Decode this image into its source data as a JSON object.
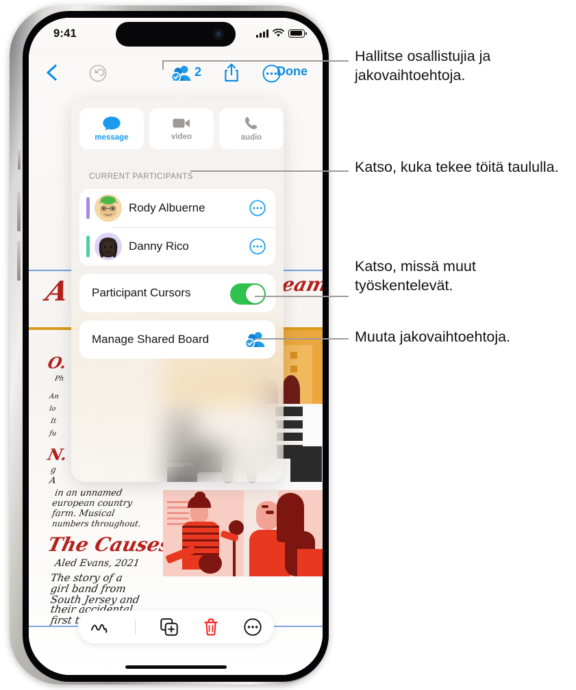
{
  "status_bar": {
    "time": "9:41",
    "cellular_icon": "signal-bars-icon",
    "wifi_icon": "wifi-icon",
    "battery_icon": "battery-icon"
  },
  "nav_bar": {
    "back_icon": "chevron-left-icon",
    "undo_icon": "undo-icon",
    "participants_icon": "participants-badge-icon",
    "participants_count": "2",
    "share_icon": "share-icon",
    "more_icon": "more-circle-icon",
    "done_label": "Done"
  },
  "popover": {
    "quick_actions": [
      {
        "label": "message",
        "icon": "message-bubble-icon",
        "state": "active"
      },
      {
        "label": "video",
        "icon": "video-camera-icon",
        "state": "inactive"
      },
      {
        "label": "audio",
        "icon": "phone-handset-icon",
        "state": "inactive"
      }
    ],
    "section_label": "CURRENT PARTICIPANTS",
    "participants": [
      {
        "name": "Rody Albuerne",
        "cursor_color": "#a98ae0",
        "avatar_bg": "#f6d7a8",
        "more_icon": "more-circle-icon"
      },
      {
        "name": "Danny Rico",
        "cursor_color": "#4ecfa0",
        "avatar_bg": "#ded3f7",
        "more_icon": "more-circle-icon"
      }
    ],
    "cursors_row": {
      "label": "Participant Cursors",
      "toggle_state": "on",
      "toggle_color": "#2fc24d"
    },
    "manage_row": {
      "label": "Manage Shared Board",
      "icon": "manage-participants-icon"
    }
  },
  "toolbar": {
    "items": [
      {
        "icon": "scribble-icon"
      },
      {
        "icon": "duplicate-add-icon"
      },
      {
        "icon": "trash-icon"
      },
      {
        "icon": "more-circle-icon"
      }
    ]
  },
  "board": {
    "handwriting": [
      {
        "text": "A",
        "style": "red-title"
      },
      {
        "text": "eam",
        "style": "red-title"
      },
      {
        "text": "O.",
        "style": "red-title"
      },
      {
        "text": "Ph",
        "style": "note"
      },
      {
        "text": "An",
        "style": "note"
      },
      {
        "text": "lo",
        "style": "note"
      },
      {
        "text": "It",
        "style": "note"
      },
      {
        "text": "fu",
        "style": "note"
      },
      {
        "text": "N.",
        "style": "red-title"
      },
      {
        "text": "g",
        "style": "note"
      },
      {
        "text": "A",
        "style": "note"
      },
      {
        "text": "in an unnamed",
        "style": "note"
      },
      {
        "text": "european country",
        "style": "note"
      },
      {
        "text": "farm. Musical",
        "style": "note"
      },
      {
        "text": "numbers throughout.",
        "style": "note"
      },
      {
        "text": "The Causes",
        "style": "red-title"
      },
      {
        "text": "Aled Evans, 2021",
        "style": "note"
      },
      {
        "text": "The story of a",
        "style": "note"
      },
      {
        "text": "girl band from",
        "style": "note"
      },
      {
        "text": "South Jersey and",
        "style": "note"
      },
      {
        "text": "their accidental",
        "style": "note"
      },
      {
        "text": "first tour.",
        "style": "note"
      }
    ]
  },
  "callouts": [
    {
      "id": "callout-participants",
      "text": "Hallitse osallistujia ja jakovaihtoehtoja."
    },
    {
      "id": "callout-current-people",
      "text": "Katso, kuka tekee töitä taululla."
    },
    {
      "id": "callout-cursors",
      "text": "Katso, missä muut työskentelevät."
    },
    {
      "id": "callout-manage",
      "text": "Muuta jakovaihtoehtoja."
    }
  ]
}
